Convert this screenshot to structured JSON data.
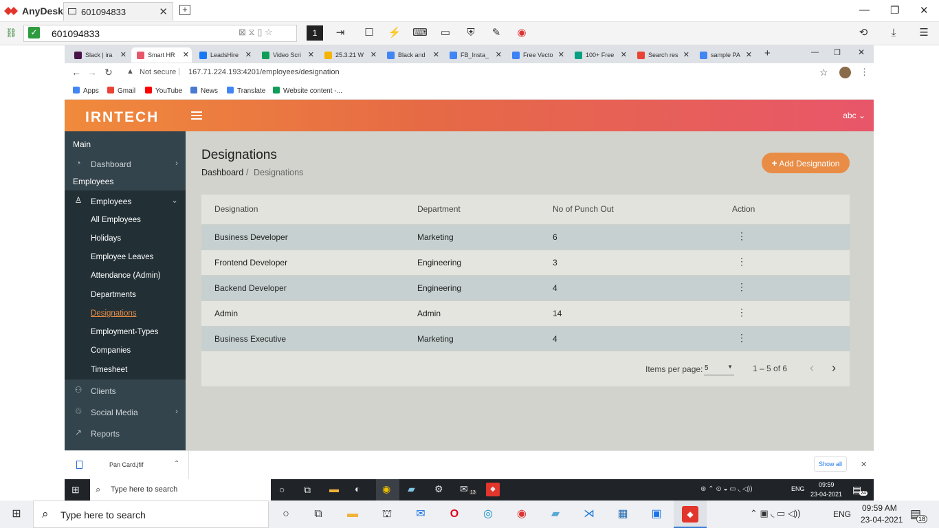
{
  "anydesk": {
    "app_name": "AnyDesk",
    "tab_label": "601094833",
    "address": "601094833"
  },
  "chrome": {
    "tabs": [
      {
        "label": "Slack | ira",
        "fav": "#4a154b"
      },
      {
        "label": "Smart HR",
        "fav": "#e8566a"
      },
      {
        "label": "LeadsHire",
        "fav": "#1877f2"
      },
      {
        "label": "Video Scri",
        "fav": "#0f9d58"
      },
      {
        "label": "25.3.21 W",
        "fav": "#f4b400"
      },
      {
        "label": "Black and",
        "fav": "#4285f4"
      },
      {
        "label": "FB_Insta_",
        "fav": "#4285f4"
      },
      {
        "label": "Free Vecto",
        "fav": "#3b82f6"
      },
      {
        "label": "100+ Free",
        "fav": "#05a081"
      },
      {
        "label": "Search res",
        "fav": "#ea4335"
      },
      {
        "label": "sample PA",
        "fav": "#4285f4"
      }
    ],
    "security": "Not secure",
    "url": "167.71.224.193:4201/employees/designation",
    "bookmarks": [
      "Apps",
      "Gmail",
      "YouTube",
      "News",
      "Translate",
      "Website content -..."
    ]
  },
  "app": {
    "logo_text": "IRNTECH",
    "user": "abc",
    "sidebar": {
      "section_main": "Main",
      "dashboard": "Dashboard",
      "section_employees": "Employees",
      "employees": "Employees",
      "sub_items": [
        "All Employees",
        "Holidays",
        "Employee Leaves",
        "Attendance (Admin)",
        "Departments",
        "Designations",
        "Employment-Types",
        "Companies",
        "Timesheet"
      ],
      "clients": "Clients",
      "social_media": "Social Media",
      "reports": "Reports"
    },
    "page_title": "Designations",
    "breadcrumb": {
      "home": "Dashboard",
      "sep": "/",
      "current": "Designations"
    },
    "add_button": "Add Designation",
    "table": {
      "headers": [
        "Designation",
        "Department",
        "No of Punch Out",
        "Action"
      ],
      "rows": [
        {
          "designation": "Business Developer",
          "department": "Marketing",
          "count": "6"
        },
        {
          "designation": "Frontend Developer",
          "department": "Engineering",
          "count": "3"
        },
        {
          "designation": "Backend Developer",
          "department": "Engineering",
          "count": "4"
        },
        {
          "designation": "Admin",
          "department": "Admin",
          "count": "14"
        },
        {
          "designation": "Business Executive",
          "department": "Marketing",
          "count": "4"
        }
      ]
    },
    "pager": {
      "items_label": "Items per page:",
      "size": "5",
      "range": "1 – 5 of 6"
    }
  },
  "download": {
    "file": "Pan Card.jfif",
    "show_all": "Show all"
  },
  "taskbar_inner": {
    "search": "Type here to search",
    "lang": "ENG",
    "time": "09:59",
    "date": "23-04-2021",
    "badge": "24",
    "mail_badge": "13"
  },
  "taskbar_outer": {
    "search": "Type here to search",
    "lang": "ENG",
    "time": "09:59 AM",
    "date": "23-04-2021",
    "badge": "18"
  },
  "colors": {
    "header_start": "#f08a3c",
    "header_end": "#e8566a",
    "sidebar": "#34444c",
    "active_link": "#e98c45",
    "add_button": "#e98c45"
  }
}
